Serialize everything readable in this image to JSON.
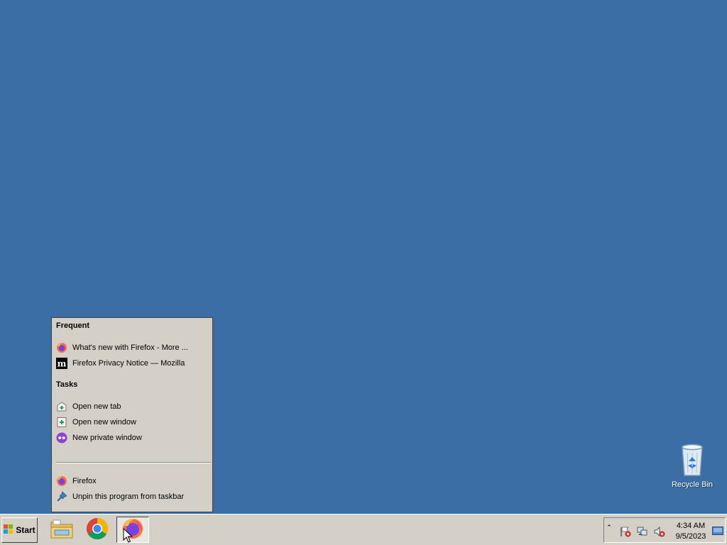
{
  "desktop": {
    "recycle_bin_label": "Recycle Bin"
  },
  "jumplist": {
    "frequent_header": "Frequent",
    "frequent_items": [
      {
        "label": "What's new with Firefox - More ...",
        "icon": "firefox-icon"
      },
      {
        "label": "Firefox Privacy Notice — Mozilla",
        "icon": "mozilla-m-icon"
      }
    ],
    "tasks_header": "Tasks",
    "task_items": [
      {
        "label": "Open new tab",
        "icon": "new-tab-icon"
      },
      {
        "label": "Open new window",
        "icon": "new-window-icon"
      },
      {
        "label": "New private window",
        "icon": "private-window-icon"
      }
    ],
    "footer_items": [
      {
        "label": "Firefox",
        "icon": "firefox-icon"
      },
      {
        "label": "Unpin this program from taskbar",
        "icon": "unpin-icon"
      }
    ]
  },
  "taskbar": {
    "start_label": "Start",
    "pinned": [
      {
        "name": "File Explorer",
        "icon": "folder-icon"
      },
      {
        "name": "Google Chrome",
        "icon": "chrome-icon"
      },
      {
        "name": "Firefox",
        "icon": "firefox-icon",
        "active": true
      }
    ],
    "tray": {
      "time": "4:34 AM",
      "date": "9/5/2023",
      "icons": [
        "action-center-flag-icon",
        "network-icon",
        "volume-muted-icon"
      ]
    }
  },
  "colors": {
    "desktop": "#3a6ea5",
    "chrome": "#d4d0c8"
  }
}
